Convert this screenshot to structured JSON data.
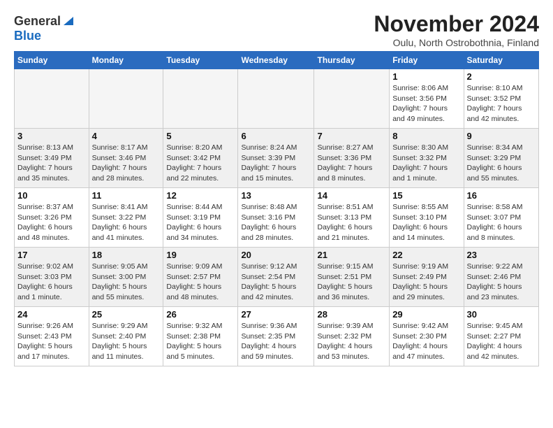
{
  "logo": {
    "general": "General",
    "blue": "Blue"
  },
  "title": "November 2024",
  "location": "Oulu, North Ostrobothnia, Finland",
  "headers": [
    "Sunday",
    "Monday",
    "Tuesday",
    "Wednesday",
    "Thursday",
    "Friday",
    "Saturday"
  ],
  "weeks": [
    [
      {
        "day": "",
        "info": ""
      },
      {
        "day": "",
        "info": ""
      },
      {
        "day": "",
        "info": ""
      },
      {
        "day": "",
        "info": ""
      },
      {
        "day": "",
        "info": ""
      },
      {
        "day": "1",
        "info": "Sunrise: 8:06 AM\nSunset: 3:56 PM\nDaylight: 7 hours\nand 49 minutes."
      },
      {
        "day": "2",
        "info": "Sunrise: 8:10 AM\nSunset: 3:52 PM\nDaylight: 7 hours\nand 42 minutes."
      }
    ],
    [
      {
        "day": "3",
        "info": "Sunrise: 8:13 AM\nSunset: 3:49 PM\nDaylight: 7 hours\nand 35 minutes."
      },
      {
        "day": "4",
        "info": "Sunrise: 8:17 AM\nSunset: 3:46 PM\nDaylight: 7 hours\nand 28 minutes."
      },
      {
        "day": "5",
        "info": "Sunrise: 8:20 AM\nSunset: 3:42 PM\nDaylight: 7 hours\nand 22 minutes."
      },
      {
        "day": "6",
        "info": "Sunrise: 8:24 AM\nSunset: 3:39 PM\nDaylight: 7 hours\nand 15 minutes."
      },
      {
        "day": "7",
        "info": "Sunrise: 8:27 AM\nSunset: 3:36 PM\nDaylight: 7 hours\nand 8 minutes."
      },
      {
        "day": "8",
        "info": "Sunrise: 8:30 AM\nSunset: 3:32 PM\nDaylight: 7 hours\nand 1 minute."
      },
      {
        "day": "9",
        "info": "Sunrise: 8:34 AM\nSunset: 3:29 PM\nDaylight: 6 hours\nand 55 minutes."
      }
    ],
    [
      {
        "day": "10",
        "info": "Sunrise: 8:37 AM\nSunset: 3:26 PM\nDaylight: 6 hours\nand 48 minutes."
      },
      {
        "day": "11",
        "info": "Sunrise: 8:41 AM\nSunset: 3:22 PM\nDaylight: 6 hours\nand 41 minutes."
      },
      {
        "day": "12",
        "info": "Sunrise: 8:44 AM\nSunset: 3:19 PM\nDaylight: 6 hours\nand 34 minutes."
      },
      {
        "day": "13",
        "info": "Sunrise: 8:48 AM\nSunset: 3:16 PM\nDaylight: 6 hours\nand 28 minutes."
      },
      {
        "day": "14",
        "info": "Sunrise: 8:51 AM\nSunset: 3:13 PM\nDaylight: 6 hours\nand 21 minutes."
      },
      {
        "day": "15",
        "info": "Sunrise: 8:55 AM\nSunset: 3:10 PM\nDaylight: 6 hours\nand 14 minutes."
      },
      {
        "day": "16",
        "info": "Sunrise: 8:58 AM\nSunset: 3:07 PM\nDaylight: 6 hours\nand 8 minutes."
      }
    ],
    [
      {
        "day": "17",
        "info": "Sunrise: 9:02 AM\nSunset: 3:03 PM\nDaylight: 6 hours\nand 1 minute."
      },
      {
        "day": "18",
        "info": "Sunrise: 9:05 AM\nSunset: 3:00 PM\nDaylight: 5 hours\nand 55 minutes."
      },
      {
        "day": "19",
        "info": "Sunrise: 9:09 AM\nSunset: 2:57 PM\nDaylight: 5 hours\nand 48 minutes."
      },
      {
        "day": "20",
        "info": "Sunrise: 9:12 AM\nSunset: 2:54 PM\nDaylight: 5 hours\nand 42 minutes."
      },
      {
        "day": "21",
        "info": "Sunrise: 9:15 AM\nSunset: 2:51 PM\nDaylight: 5 hours\nand 36 minutes."
      },
      {
        "day": "22",
        "info": "Sunrise: 9:19 AM\nSunset: 2:49 PM\nDaylight: 5 hours\nand 29 minutes."
      },
      {
        "day": "23",
        "info": "Sunrise: 9:22 AM\nSunset: 2:46 PM\nDaylight: 5 hours\nand 23 minutes."
      }
    ],
    [
      {
        "day": "24",
        "info": "Sunrise: 9:26 AM\nSunset: 2:43 PM\nDaylight: 5 hours\nand 17 minutes."
      },
      {
        "day": "25",
        "info": "Sunrise: 9:29 AM\nSunset: 2:40 PM\nDaylight: 5 hours\nand 11 minutes."
      },
      {
        "day": "26",
        "info": "Sunrise: 9:32 AM\nSunset: 2:38 PM\nDaylight: 5 hours\nand 5 minutes."
      },
      {
        "day": "27",
        "info": "Sunrise: 9:36 AM\nSunset: 2:35 PM\nDaylight: 4 hours\nand 59 minutes."
      },
      {
        "day": "28",
        "info": "Sunrise: 9:39 AM\nSunset: 2:32 PM\nDaylight: 4 hours\nand 53 minutes."
      },
      {
        "day": "29",
        "info": "Sunrise: 9:42 AM\nSunset: 2:30 PM\nDaylight: 4 hours\nand 47 minutes."
      },
      {
        "day": "30",
        "info": "Sunrise: 9:45 AM\nSunset: 2:27 PM\nDaylight: 4 hours\nand 42 minutes."
      }
    ]
  ]
}
